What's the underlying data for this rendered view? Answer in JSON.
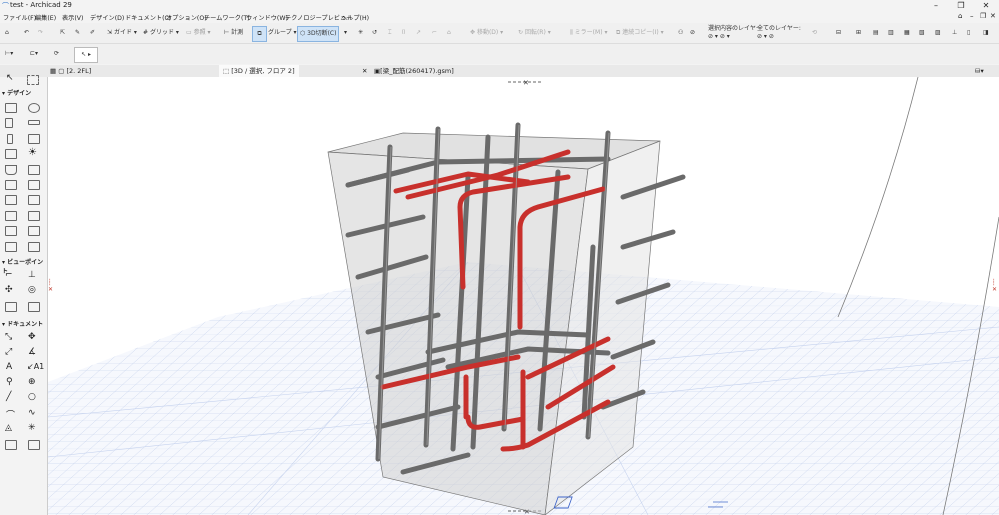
{
  "window": {
    "title": "test - Archicad 29"
  },
  "menu": [
    "ファイル(F)",
    "編集(E)",
    "表示(V)",
    "デザイン(D)",
    "ドキュメント(C)",
    "オプション(O)",
    "チームワーク(T)",
    "ウィンドウ(W)",
    "テクノロジープレビュー",
    "ヘルプ(H)"
  ],
  "toolbar": {
    "guide": "ガイド",
    "grid": "グリッド",
    "reference": "参照",
    "measure": "計測",
    "group": "グループ",
    "cut3d": "3D切断(C)",
    "move": "移動(D)",
    "rotate": "回転(R)",
    "mirror": "ミラー(M)",
    "multiply": "連続コピー(I)",
    "layers_selected": "選択内容のレイヤー",
    "layers_all": "全てのレイヤー:"
  },
  "tabs": [
    {
      "label": "[2. 2FL]"
    },
    {
      "label": "[3D / 選択, フロア 2]"
    },
    {
      "label": "[梁_配筋(260417).gsm]"
    }
  ],
  "toolbox": {
    "design": "デザイン",
    "viewpoint": "ビューポイント",
    "document": "ドキュメント"
  },
  "colors": {
    "rebar_gray": "#6a6a6a",
    "rebar_red": "#c8302c",
    "grid_line": "#a9bde6",
    "concrete": "#dcdcdc"
  }
}
